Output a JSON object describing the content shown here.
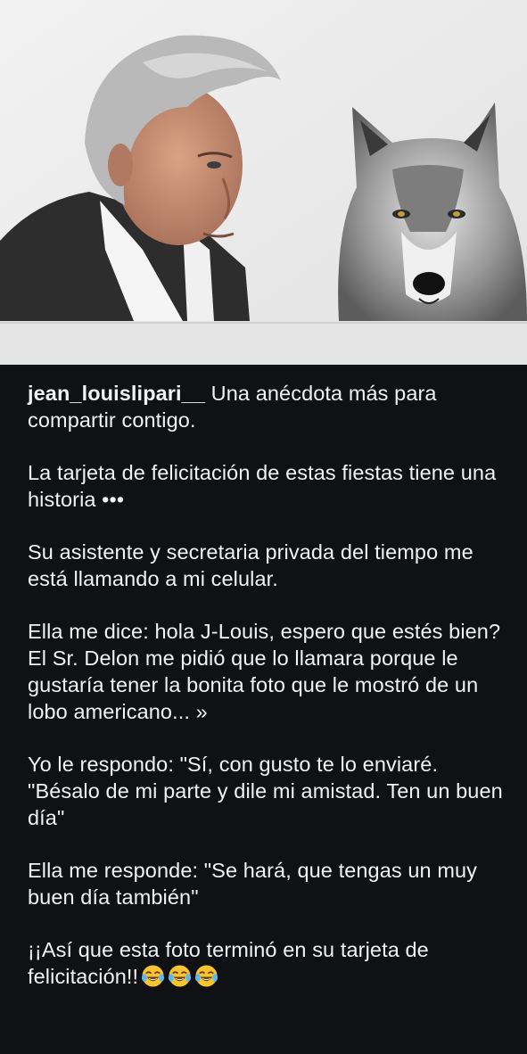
{
  "post": {
    "image": {
      "subjects": [
        "portrait-of-man",
        "wolf"
      ]
    },
    "caption": {
      "username": "jean_louislipari__",
      "paragraphs": [
        "Una anécdota más para compartir contigo.",
        "La tarjeta de felicitación de estas fiestas tiene una historia •••",
        "Su asistente y secretaria privada del tiempo me está llamando a mi celular.",
        "Ella me dice: hola J-Louis, espero que estés bien? El Sr. Delon me pidió que lo llamara porque le gustaría tener la bonita foto que le mostró de un lobo americano... »",
        "Yo le respondo: \"Sí, con gusto te lo enviaré. \"Bésalo de mi parte y dile mi amistad. Ten un buen día\"",
        "Ella me responde: \"Se hará, que tengas un muy buen día también\"",
        "¡¡Así que esta foto terminó en su tarjeta de felicitación!!"
      ],
      "trailing_emojis": [
        "face-with-tears-of-joy",
        "face-with-tears-of-joy",
        "face-with-tears-of-joy"
      ]
    }
  },
  "colors": {
    "background": "#0f1115",
    "text": "#f2f2f2",
    "photo_background": "#ececec"
  }
}
